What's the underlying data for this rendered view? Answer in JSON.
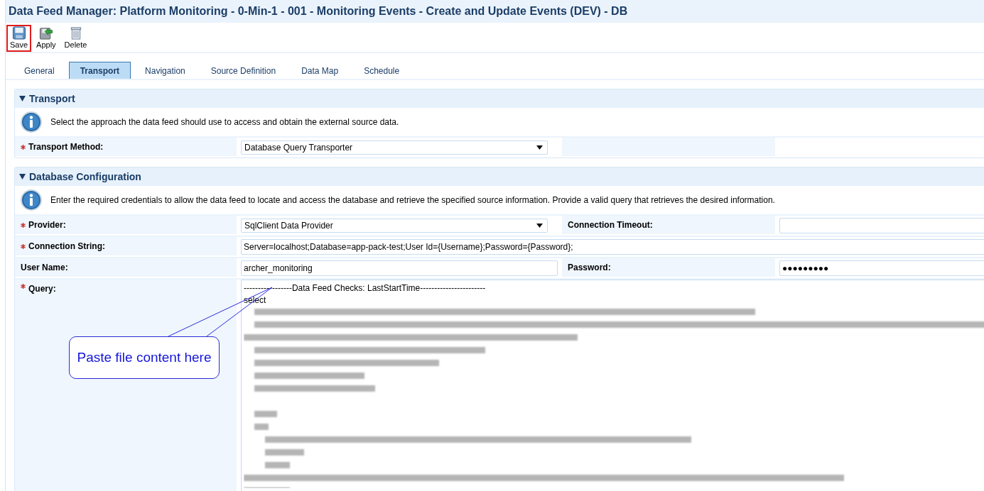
{
  "window": {
    "title": "Data Feed Manager: Platform Monitoring - 0-Min-1 - 001 - Monitoring Events - Create and Update Events (DEV) - DB"
  },
  "toolbar": [
    {
      "label": "Save",
      "kind": "save",
      "selected": true
    },
    {
      "label": "Apply",
      "kind": "apply",
      "selected": false
    },
    {
      "label": "Delete",
      "kind": "delete",
      "selected": false
    }
  ],
  "tabs": [
    {
      "label": "General",
      "selected": false
    },
    {
      "label": "Transport",
      "selected": true
    },
    {
      "label": "Navigation",
      "selected": false
    },
    {
      "label": "Source Definition",
      "selected": false
    },
    {
      "label": "Data Map",
      "selected": false
    },
    {
      "label": "Schedule",
      "selected": false
    }
  ],
  "sections": [
    {
      "title": "Transport",
      "expanded": true,
      "info": "Select the approach the data feed should use to access and obtain the external source data.",
      "rows": [
        {
          "kind": "single",
          "fields": [
            {
              "label": "Transport Method:",
              "required": true,
              "kind": "select",
              "value": "Database Query Transporter"
            }
          ]
        }
      ]
    },
    {
      "title": "Database Configuration",
      "expanded": true,
      "info": "Enter the required credentials to allow the data feed to locate and access the database and retrieve the specified source information. Provide a valid query that retrieves the desired information.",
      "rows": [
        {
          "kind": "pair",
          "fields": [
            {
              "label": "Provider:",
              "required": true,
              "kind": "select",
              "value": "SqlClient Data Provider"
            },
            {
              "label": "Connection Timeout:",
              "required": false,
              "kind": "text"
            }
          ]
        },
        {
          "kind": "wide",
          "fields": [
            {
              "label": "Connection String:",
              "required": true,
              "kind": "text",
              "value": "Server=localhost;Database=app-pack-test;User Id={Username};Password={Password};"
            }
          ]
        },
        {
          "kind": "pair",
          "fields": [
            {
              "label": "User Name:",
              "required": false,
              "kind": "text",
              "value": "archer_monitoring"
            },
            {
              "label": "Password:",
              "required": false,
              "kind": "text",
              "value": "●●●●●●●●●"
            }
          ]
        },
        {
          "kind": "query",
          "fields": [
            {
              "label": "Query:",
              "required": true,
              "kind": "textarea",
              "lines": [
                "-----------------Data Feed Checks: LastStartTime-----------------------",
                "select"
              ]
            }
          ]
        }
      ]
    }
  ],
  "callout": {
    "text": "Paste file content here"
  }
}
